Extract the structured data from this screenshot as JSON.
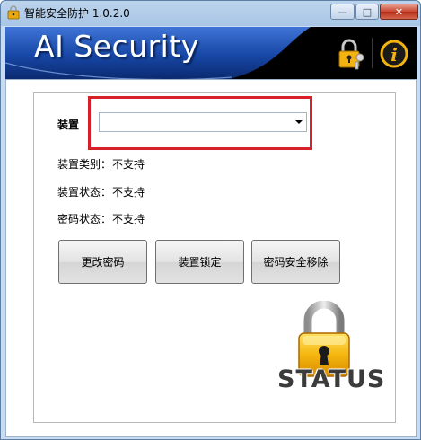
{
  "window": {
    "title": "智能安全防护 1.0.2.0",
    "controls": {
      "minimize": "—",
      "maximize": "□",
      "close": "✕"
    }
  },
  "banner": {
    "title": "AI Security",
    "icons": [
      "key-lock-icon",
      "info-icon"
    ]
  },
  "device": {
    "label": "装置",
    "select_value": ""
  },
  "info_rows": [
    {
      "label": "装置类别：",
      "value": "不支持"
    },
    {
      "label": "装置状态：",
      "value": "不支持"
    },
    {
      "label": "密码状态：",
      "value": "不支持"
    }
  ],
  "buttons": {
    "change_password": "更改密码",
    "lock_device": "装置锁定",
    "secure_remove": "密码安全移除"
  },
  "status": {
    "label": "STATUS",
    "state": "locked"
  },
  "colors": {
    "highlight": "#d8202a",
    "banner_blue": "#1a4aa8",
    "lock_gold": "#f2b20f"
  }
}
